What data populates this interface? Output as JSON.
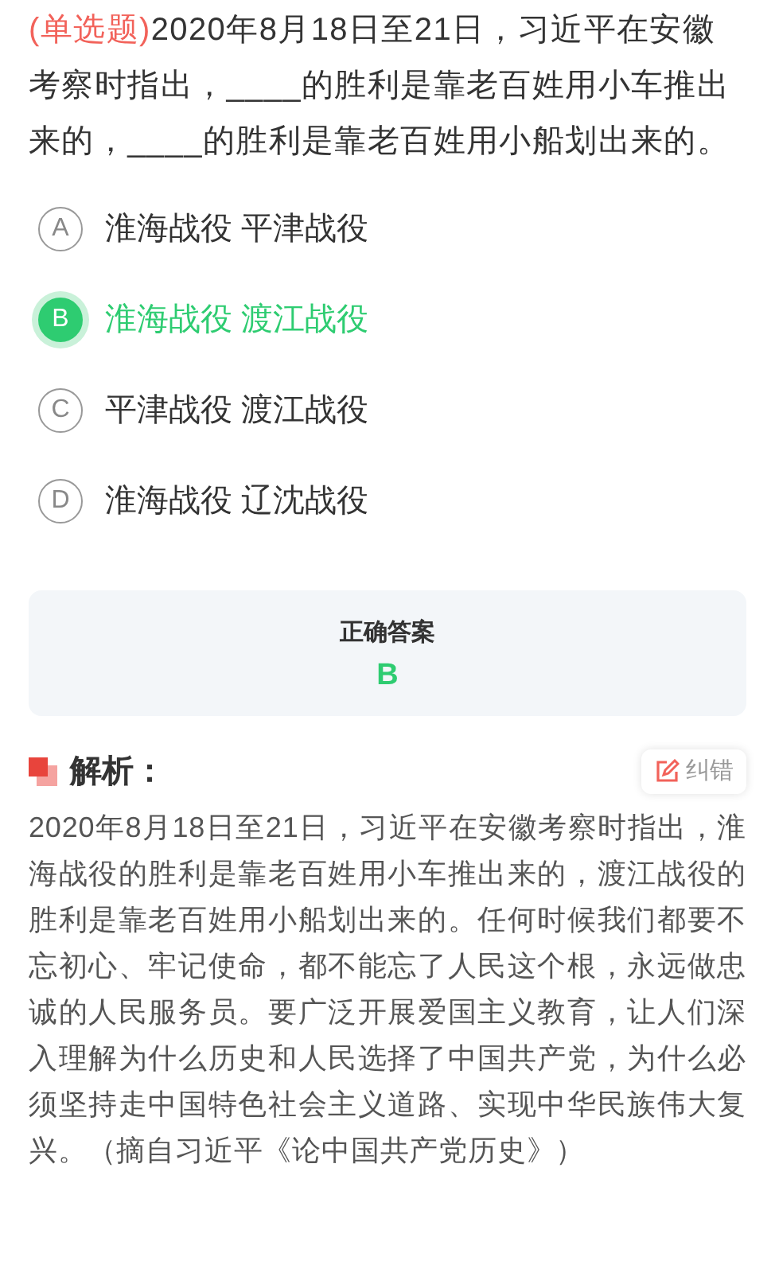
{
  "question": {
    "type": "(单选题)",
    "text": "2020年8月18日至21日，习近平在安徽考察时指出，____的胜利是靠老百姓用小车推出来的，____的胜利是靠老百姓用小船划出来的。"
  },
  "options": [
    {
      "letter": "A",
      "text": "淮海战役 平津战役",
      "selected": false
    },
    {
      "letter": "B",
      "text": "淮海战役 渡江战役",
      "selected": true
    },
    {
      "letter": "C",
      "text": "平津战役 渡江战役",
      "selected": false
    },
    {
      "letter": "D",
      "text": "淮海战役 辽沈战役",
      "selected": false
    }
  ],
  "answer": {
    "label": "正确答案",
    "value": "B"
  },
  "analysis": {
    "title": "解析：",
    "report_button": "纠错",
    "text": "2020年8月18日至21日，习近平在安徽考察时指出，淮海战役的胜利是靠老百姓用小车推出来的，渡江战役的胜利是靠老百姓用小船划出来的。任何时候我们都要不忘初心、牢记使命，都不能忘了人民这个根，永远做忠诚的人民服务员。要广泛开展爱国主义教育，让人们深入理解为什么历史和人民选择了中国共产党，为什么必须坚持走中国特色社会主义道路、实现中华民族伟大复兴。（摘自习近平《论中国共产党历史》）"
  }
}
